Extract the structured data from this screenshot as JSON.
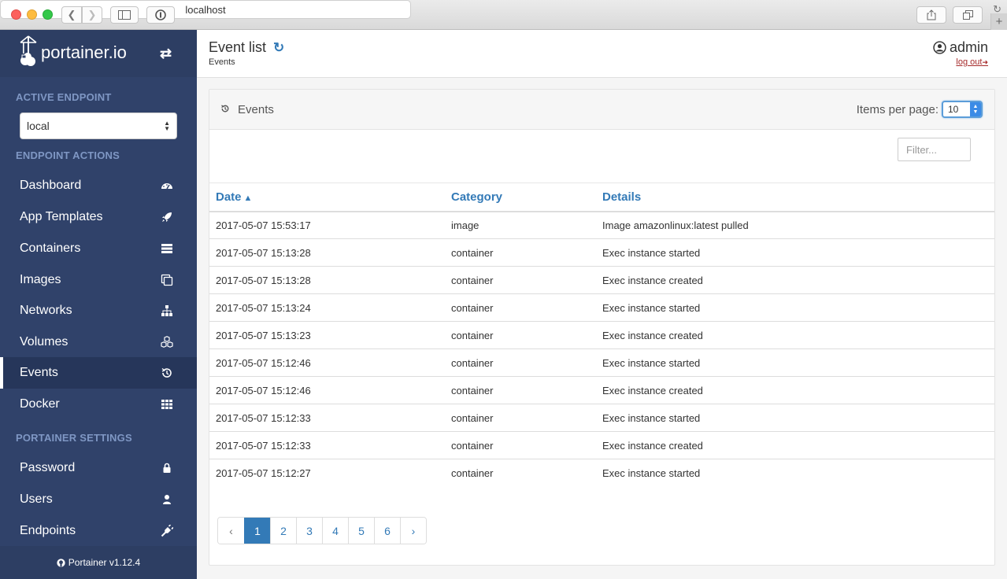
{
  "browser": {
    "url": "localhost"
  },
  "sidebar": {
    "brand": "portainer.io",
    "active_endpoint_title": "ACTIVE ENDPOINT",
    "endpoint_selected": "local",
    "endpoint_actions_title": "ENDPOINT ACTIONS",
    "settings_title": "PORTAINER SETTINGS",
    "items": [
      {
        "label": "Dashboard",
        "icon": "dashboard-icon"
      },
      {
        "label": "App Templates",
        "icon": "rocket-icon"
      },
      {
        "label": "Containers",
        "icon": "server-icon"
      },
      {
        "label": "Images",
        "icon": "clone-icon"
      },
      {
        "label": "Networks",
        "icon": "sitemap-icon"
      },
      {
        "label": "Volumes",
        "icon": "cubes-icon"
      },
      {
        "label": "Events",
        "icon": "history-icon",
        "active": true
      },
      {
        "label": "Docker",
        "icon": "th-icon"
      }
    ],
    "settings_items": [
      {
        "label": "Password",
        "icon": "lock-icon"
      },
      {
        "label": "Users",
        "icon": "user-icon"
      },
      {
        "label": "Endpoints",
        "icon": "plug-icon"
      }
    ],
    "footer": "Portainer v1.12.4"
  },
  "header": {
    "title": "Event list",
    "breadcrumb": "Events",
    "username": "admin",
    "logout": "log out"
  },
  "widget": {
    "title": "Events",
    "items_per_page_label": "Items per page:",
    "items_per_page_value": "10",
    "filter_placeholder": "Filter...",
    "columns": [
      "Date",
      "Category",
      "Details"
    ],
    "rows": [
      [
        "2017-05-07 15:53:17",
        "image",
        "Image amazonlinux:latest pulled"
      ],
      [
        "2017-05-07 15:13:28",
        "container",
        "Exec instance started"
      ],
      [
        "2017-05-07 15:13:28",
        "container",
        "Exec instance created"
      ],
      [
        "2017-05-07 15:13:24",
        "container",
        "Exec instance started"
      ],
      [
        "2017-05-07 15:13:23",
        "container",
        "Exec instance created"
      ],
      [
        "2017-05-07 15:12:46",
        "container",
        "Exec instance started"
      ],
      [
        "2017-05-07 15:12:46",
        "container",
        "Exec instance created"
      ],
      [
        "2017-05-07 15:12:33",
        "container",
        "Exec instance started"
      ],
      [
        "2017-05-07 15:12:33",
        "container",
        "Exec instance created"
      ],
      [
        "2017-05-07 15:12:27",
        "container",
        "Exec instance started"
      ]
    ],
    "pagination": {
      "prev": "‹",
      "pages": [
        "1",
        "2",
        "3",
        "4",
        "5",
        "6"
      ],
      "current": "1",
      "next": "›"
    }
  },
  "colors": {
    "sidebar_bg": "#30426a",
    "accent": "#337ab7",
    "section_title": "#7f97c4"
  }
}
